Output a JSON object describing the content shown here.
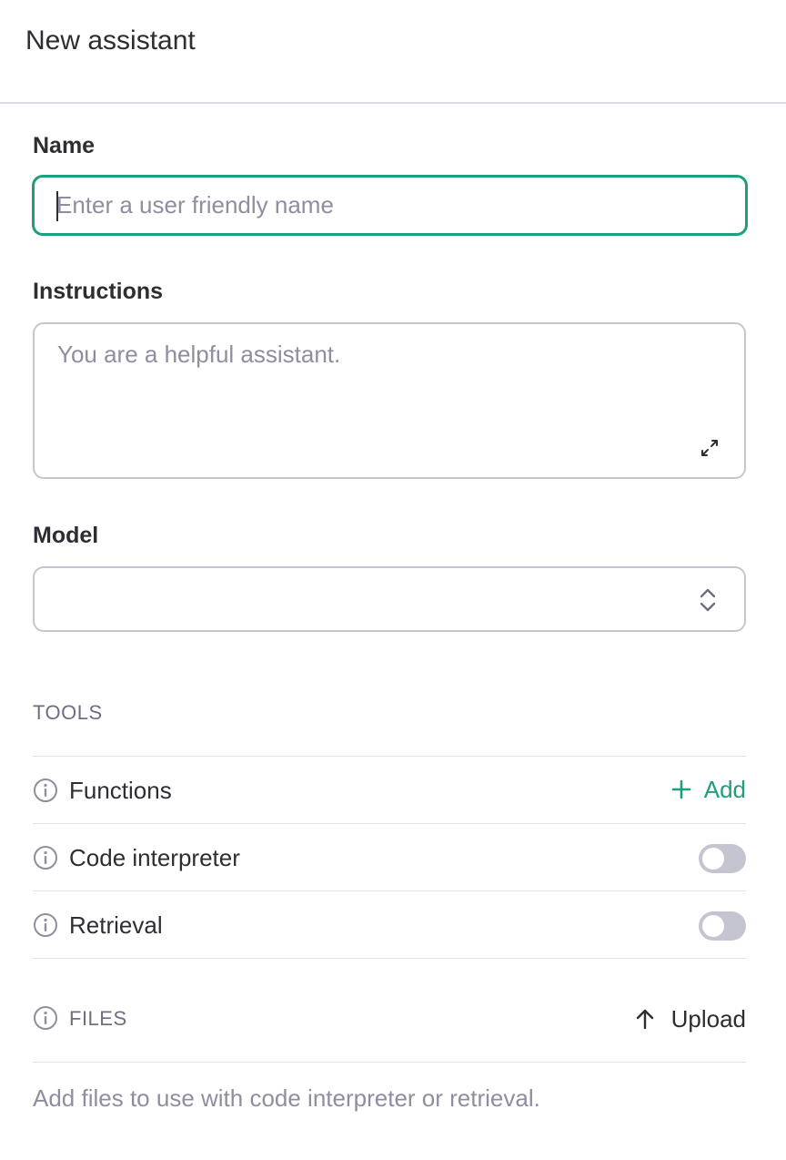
{
  "header": {
    "title": "New assistant"
  },
  "name_field": {
    "label": "Name",
    "value": "",
    "placeholder": "Enter a user friendly name"
  },
  "instructions_field": {
    "label": "Instructions",
    "value": "",
    "placeholder": "You are a helpful assistant."
  },
  "model_field": {
    "label": "Model",
    "selected": ""
  },
  "tools": {
    "title": "TOOLS",
    "functions": {
      "label": "Functions",
      "action_label": "Add"
    },
    "code_interpreter": {
      "label": "Code interpreter",
      "enabled": false
    },
    "retrieval": {
      "label": "Retrieval",
      "enabled": false
    }
  },
  "files": {
    "title": "FILES",
    "upload_label": "Upload",
    "hint": "Add files to use with code interpreter or retrieval."
  },
  "colors": {
    "accent": "#1e9e7c",
    "toggle_off": "#c5c5d2",
    "text": "#2d2e33",
    "muted": "#8e8ea0"
  },
  "icons": {
    "info": "info-icon",
    "expand": "expand-icon",
    "select": "chevron-up-down-icon",
    "add": "plus-icon",
    "upload": "arrow-up-icon"
  }
}
